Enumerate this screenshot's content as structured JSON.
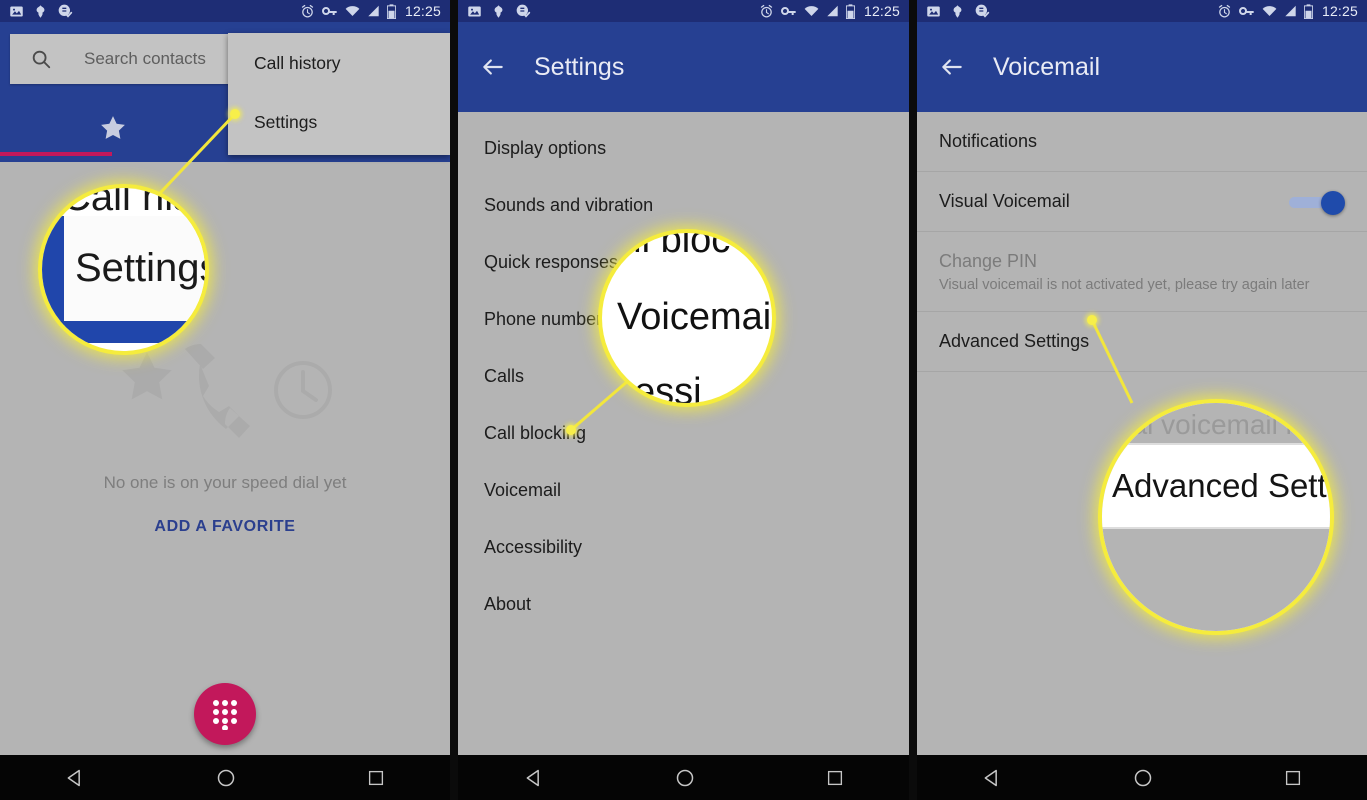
{
  "status_bar": {
    "time": "12:25",
    "left_icons": [
      "image-icon",
      "leaf-icon",
      "sync-check-icon"
    ],
    "right_icons": [
      "alarm-icon",
      "vpn-key-icon",
      "wifi-icon",
      "signal-icon",
      "battery-icon"
    ]
  },
  "colors": {
    "appbar_blue": "#264092",
    "statusbar_blue": "#1e2d75",
    "page_gray": "#b4b4b4",
    "accent_pink": "#c2185b",
    "callout_yellow": "#f5ec3d",
    "link_blue": "#2b3f8e",
    "toggle_on": "#1f4bab"
  },
  "panel1": {
    "search": {
      "placeholder": "Search contacts",
      "icon": "search-icon"
    },
    "tabs": [
      {
        "name": "favorites",
        "icon": "star-icon",
        "active": true
      },
      {
        "name": "recents",
        "icon": "clock-icon",
        "active": false
      }
    ],
    "overflow_menu": {
      "items": [
        {
          "label": "Call history"
        },
        {
          "label": "Settings"
        }
      ]
    },
    "empty_state": {
      "message": "No one is on your speed dial yet",
      "cta": "ADD A FAVORITE"
    },
    "fab": {
      "icon": "dialpad-icon"
    },
    "magnifier": {
      "target": "Settings",
      "ghost_above": "Call his"
    }
  },
  "panel2": {
    "title": "Settings",
    "back": "back-arrow-icon",
    "items": [
      {
        "label": "Display options"
      },
      {
        "label": "Sounds and vibration"
      },
      {
        "label": "Quick responses"
      },
      {
        "label": "Phone number lookup"
      },
      {
        "label": "Calls"
      },
      {
        "label": "Call blocking"
      },
      {
        "label": "Voicemail"
      },
      {
        "label": "Accessibility"
      },
      {
        "label": "About"
      }
    ],
    "magnifier": {
      "target": "Voicemail",
      "ghost_above": "all bloc",
      "ghost_below": "cessi"
    }
  },
  "panel3": {
    "title": "Voicemail",
    "back": "back-arrow-icon",
    "items": [
      {
        "label": "Notifications",
        "subtitle": "",
        "disabled": false,
        "toggle": null
      },
      {
        "label": "Visual Voicemail",
        "subtitle": "",
        "disabled": false,
        "toggle": "on"
      },
      {
        "label": "Change PIN",
        "subtitle": "Visual voicemail is not activated yet, please try again later",
        "disabled": true,
        "toggle": null
      },
      {
        "label": "Advanced Settings",
        "subtitle": "",
        "disabled": false,
        "toggle": null
      }
    ],
    "magnifier": {
      "target": "Advanced Settings",
      "ghost_above": "ual voicemail is"
    }
  },
  "nav_bar": {
    "buttons": [
      {
        "name": "back-button",
        "icon": "triangle-back-icon"
      },
      {
        "name": "home-button",
        "icon": "circle-home-icon"
      },
      {
        "name": "recents-button",
        "icon": "square-recents-icon"
      }
    ]
  }
}
